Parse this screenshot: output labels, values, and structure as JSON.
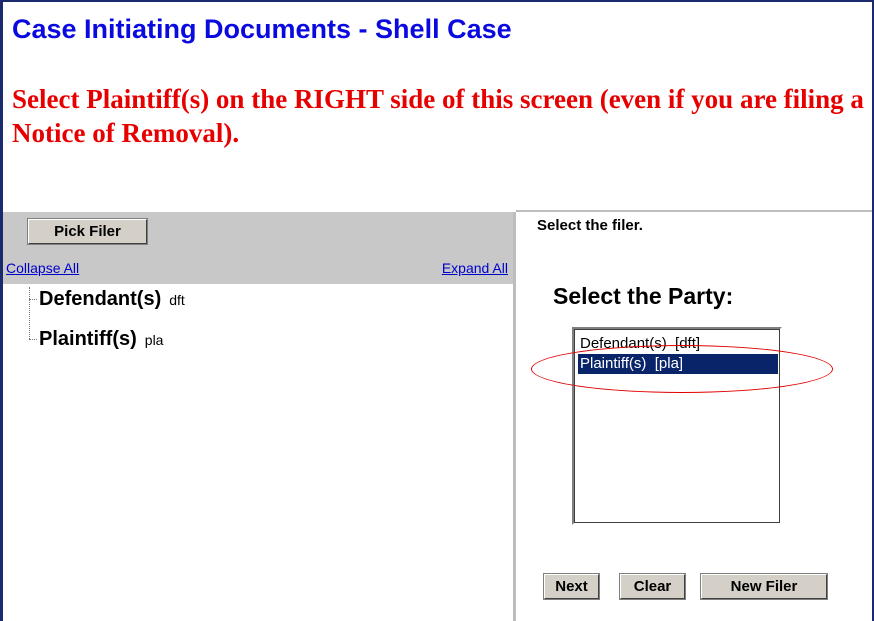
{
  "page": {
    "title": "Case Initiating Documents - Shell Case",
    "instructions": "Select Plaintiff(s) on the RIGHT side of this screen (even if you are filing a Notice of Removal)."
  },
  "left_panel": {
    "pick_filer_label": "Pick Filer",
    "collapse_all": "Collapse All",
    "expand_all": "Expand All",
    "tree": [
      {
        "label": "Defendant(s)",
        "code": "dft"
      },
      {
        "label": "Plaintiff(s)",
        "code": "pla"
      }
    ]
  },
  "right_panel": {
    "instruction": "Select the filer.",
    "heading": "Select the Party:",
    "options": [
      {
        "label": "Defendant(s)  [dft]",
        "selected": false
      },
      {
        "label": "Plaintiff(s)  [pla]",
        "selected": true
      }
    ],
    "buttons": {
      "next": "Next",
      "clear": "Clear",
      "new_filer": "New Filer"
    }
  },
  "colors": {
    "title": "#0a0ae0",
    "instruction_text": "#e60000",
    "selection": "#0a246a",
    "annotation": "#e00000"
  }
}
